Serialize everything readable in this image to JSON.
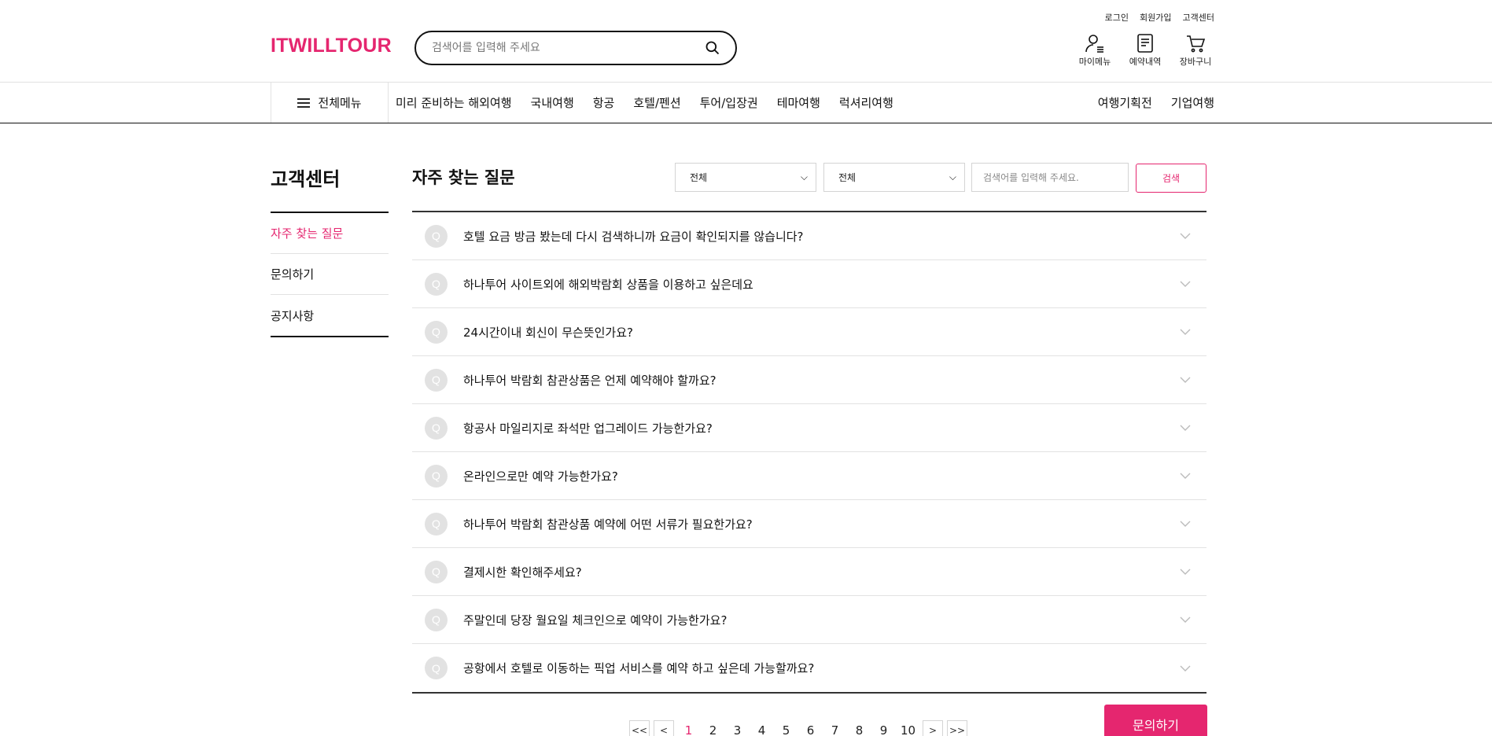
{
  "brand": {
    "logo": "ITWILLTOUR",
    "accent": "#e5266f"
  },
  "top_util": [
    "로그인",
    "회원가입",
    "고객센터"
  ],
  "search": {
    "placeholder": "검색어를 입력해 주세요"
  },
  "header_icons": [
    {
      "label": "마이메뉴",
      "icon": "user-icon"
    },
    {
      "label": "예약내역",
      "icon": "document-icon"
    },
    {
      "label": "장바구니",
      "icon": "cart-icon"
    }
  ],
  "gnb": {
    "all_menu": "전체메뉴",
    "items": [
      "미리 준비하는 해외여행",
      "국내여행",
      "항공",
      "호텔/펜션",
      "투어/입장권",
      "테마여행",
      "럭셔리여행"
    ],
    "right_items": [
      "여행기획전",
      "기업여행"
    ]
  },
  "sidebar": {
    "title": "고객센터",
    "items": [
      {
        "label": "자주 찾는 질문",
        "active": true
      },
      {
        "label": "문의하기",
        "active": false
      },
      {
        "label": "공지사항",
        "active": false
      }
    ]
  },
  "main": {
    "title": "자주 찾는 질문",
    "filter1": "전체",
    "filter2": "전체",
    "search_placeholder": "검색어를 입력해 주세요.",
    "search_button": "검색",
    "badge": "Q",
    "faqs": [
      "호텔 요금 방금 봤는데 다시 검색하니까 요금이 확인되지를 않습니다?",
      "하나투어 사이트외에 해외박람회 상품을 이용하고 싶은데요",
      "24시간이내 회신이 무슨뜻인가요?",
      "하나투어 박람회 참관상품은 언제 예약해야 할까요?",
      "항공사 마일리지로 좌석만 업그레이드 가능한가요?",
      "온라인으로만 예약 가능한가요?",
      "하나투어 박람회 참관상품 예약에 어떤 서류가 필요한가요?",
      "결제시한 확인해주세요?",
      "주말인데 당장 월요일 체크인으로 예약이 가능한가요?",
      "공항에서 호텔로 이동하는 픽업 서비스를 예약 하고 싶은데 가능할까요?"
    ]
  },
  "pagination": {
    "first": "<<",
    "prev": "<",
    "next": ">",
    "last": ">>",
    "pages": [
      "1",
      "2",
      "3",
      "4",
      "5",
      "6",
      "7",
      "8",
      "9",
      "10"
    ],
    "current": "1"
  },
  "ask_button": "문의하기"
}
